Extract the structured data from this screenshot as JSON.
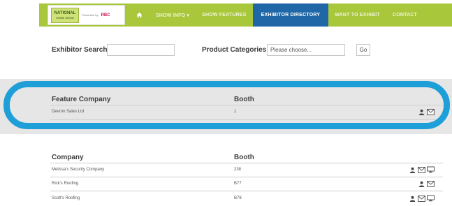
{
  "header": {
    "logo": {
      "name": "NATIONAL",
      "tagline": "HOME SHOW",
      "powered_by": "Presented by",
      "brand": "RBC"
    },
    "nav": [
      {
        "label": "",
        "icon": "home-icon"
      },
      {
        "label": "SHOW INFO ▾"
      },
      {
        "label": "SHOW FEATURES"
      },
      {
        "label": "EXHIBITOR DIRECTORY",
        "active": true
      },
      {
        "label": "WANT TO EXHIBIT"
      },
      {
        "label": "CONTACT"
      }
    ],
    "accent": "#a8c73a",
    "active_color": "#1f67a7"
  },
  "search": {
    "exhibitor_label": "Exhibitor Search",
    "exhibitor_value": "",
    "category_label": "Product Categories",
    "category_value": "Please choose...",
    "go_label": "Go"
  },
  "featured": {
    "company_header": "Feature Company",
    "booth_header": "Booth",
    "rows": [
      {
        "company": "Devron Sales Ltd",
        "booth": "1",
        "icons": [
          "person-icon",
          "mail-icon"
        ]
      }
    ],
    "highlight_color": "#1e9fd8"
  },
  "directory": {
    "company_header": "Company",
    "booth_header": "Booth",
    "rows": [
      {
        "company": "Melissa's Security Company",
        "booth": "238",
        "icons": [
          "person-icon",
          "mail-icon",
          "monitor-icon"
        ]
      },
      {
        "company": "Rick's Roofing",
        "booth": "B77",
        "icons": [
          "person-icon",
          "mail-icon"
        ]
      },
      {
        "company": "Scott's Roofing",
        "booth": "B78",
        "icons": [
          "person-icon",
          "mail-icon",
          "monitor-icon"
        ]
      }
    ]
  }
}
